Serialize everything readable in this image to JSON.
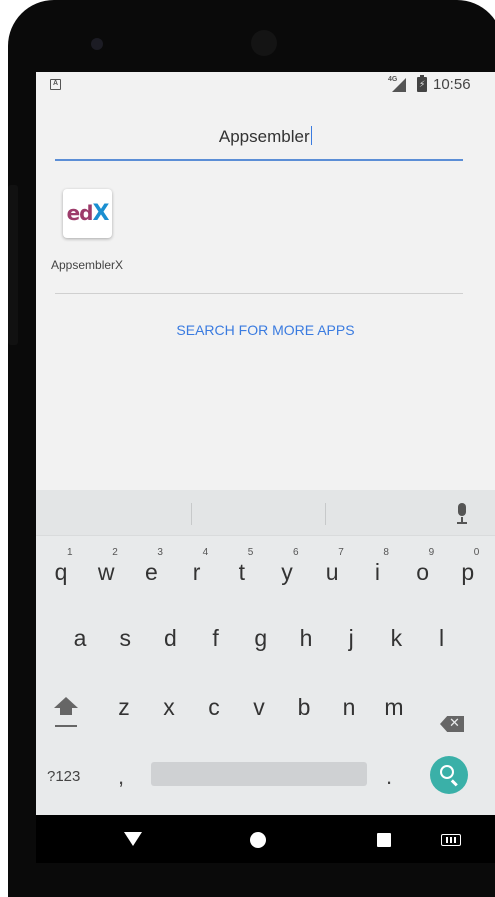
{
  "status_bar": {
    "network_label": "4G",
    "time": "10:56"
  },
  "search": {
    "query": "Appsembler"
  },
  "results": [
    {
      "app_name": "AppsemblerX",
      "icon_letters": {
        "e": "e",
        "d": "d",
        "x": "X"
      }
    }
  ],
  "more_apps_label": "SEARCH FOR MORE APPS",
  "keyboard": {
    "row1": [
      {
        "k": "q",
        "h": "1"
      },
      {
        "k": "w",
        "h": "2"
      },
      {
        "k": "e",
        "h": "3"
      },
      {
        "k": "r",
        "h": "4"
      },
      {
        "k": "t",
        "h": "5"
      },
      {
        "k": "y",
        "h": "6"
      },
      {
        "k": "u",
        "h": "7"
      },
      {
        "k": "i",
        "h": "8"
      },
      {
        "k": "o",
        "h": "9"
      },
      {
        "k": "p",
        "h": "0"
      }
    ],
    "row2": [
      "a",
      "s",
      "d",
      "f",
      "g",
      "h",
      "j",
      "k",
      "l"
    ],
    "row3": [
      "z",
      "x",
      "c",
      "v",
      "b",
      "n",
      "m"
    ],
    "symbols_label": "?123",
    "comma": ",",
    "period": ".",
    "icons": {
      "mic": "mic-icon",
      "shift": "shift-icon",
      "backspace": "backspace-icon",
      "search": "search-icon"
    }
  },
  "colors": {
    "accent": "#3a7be0",
    "go_button": "#3ab0a8",
    "screen_bg": "#f2f2f2"
  }
}
